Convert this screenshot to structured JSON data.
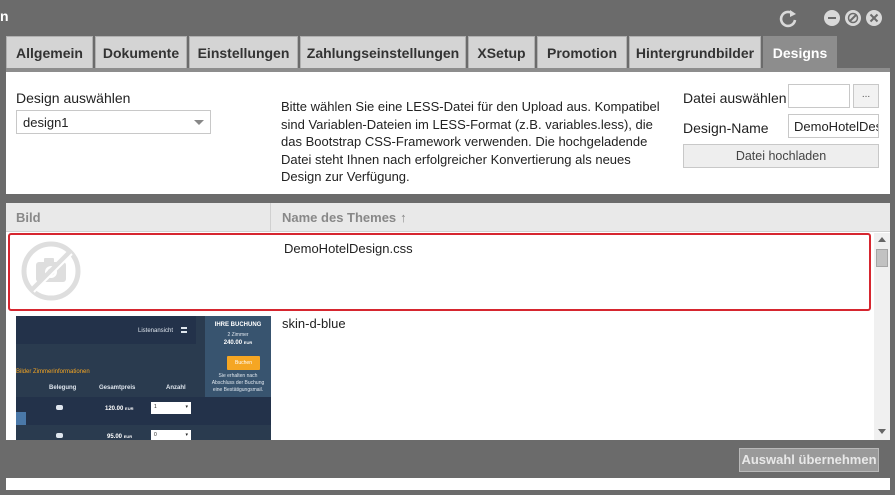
{
  "window": {
    "title": "n"
  },
  "tabs": [
    {
      "label": "Allgemein"
    },
    {
      "label": "Dokumente"
    },
    {
      "label": "Einstellungen"
    },
    {
      "label": "Zahlungseinstellungen"
    },
    {
      "label": "XSetup"
    },
    {
      "label": "Promotion"
    },
    {
      "label": "Hintergrundbilder"
    },
    {
      "label": "Designs",
      "active": true
    }
  ],
  "design_panel": {
    "select_label": "Design auswählen",
    "select_value": "design1",
    "info_text": "Bitte wählen Sie eine LESS-Datei für den Upload aus. Kompatibel sind Variablen-Dateien im LESS-Format (z.B. variables.less), die das Bootstrap CSS-Framework verwenden. Die hochgeladende Datei steht Ihnen nach erfolgreicher Konvertierung als neues Design zur Verfügung.",
    "file_label": "Datei auswählen",
    "file_browse_label": "...",
    "name_label": "Design-Name",
    "name_value": "DemoHotelDesign",
    "upload_label": "Datei hochladen"
  },
  "table": {
    "col_image": "Bild",
    "col_name": "Name des Themes",
    "rows": [
      {
        "name": "DemoHotelDesign.css",
        "has_image": false,
        "selected": true
      },
      {
        "name": "skin-d-blue",
        "has_image": true
      }
    ]
  },
  "preview": {
    "list_view": "Listenansicht",
    "booking_title": "IHRE BUCHUNG",
    "booking_rooms": "2 Zimmer",
    "booking_price": "240.00",
    "booking_currency": "EUR",
    "book_button": "Buchen",
    "booking_note": "Sie erhalten nach Abschluss der Buchung eine Bestätigungsmail.",
    "links": "Bilder     Zimmerinformationen",
    "col_occupancy": "Belegung",
    "col_total": "Gesamtpreis",
    "col_count": "Anzahl",
    "row1_price": "120.00",
    "row1_currency": "EUR",
    "row1_count": "1",
    "row2_price": "95.00",
    "row2_currency": "EUR",
    "row2_count": "0"
  },
  "footer": {
    "apply_label": "Auswahl übernehmen"
  },
  "colors": {
    "active_tab": "#8d8d8d",
    "selection_border": "#d6262f",
    "background": "#6b6b6b"
  }
}
